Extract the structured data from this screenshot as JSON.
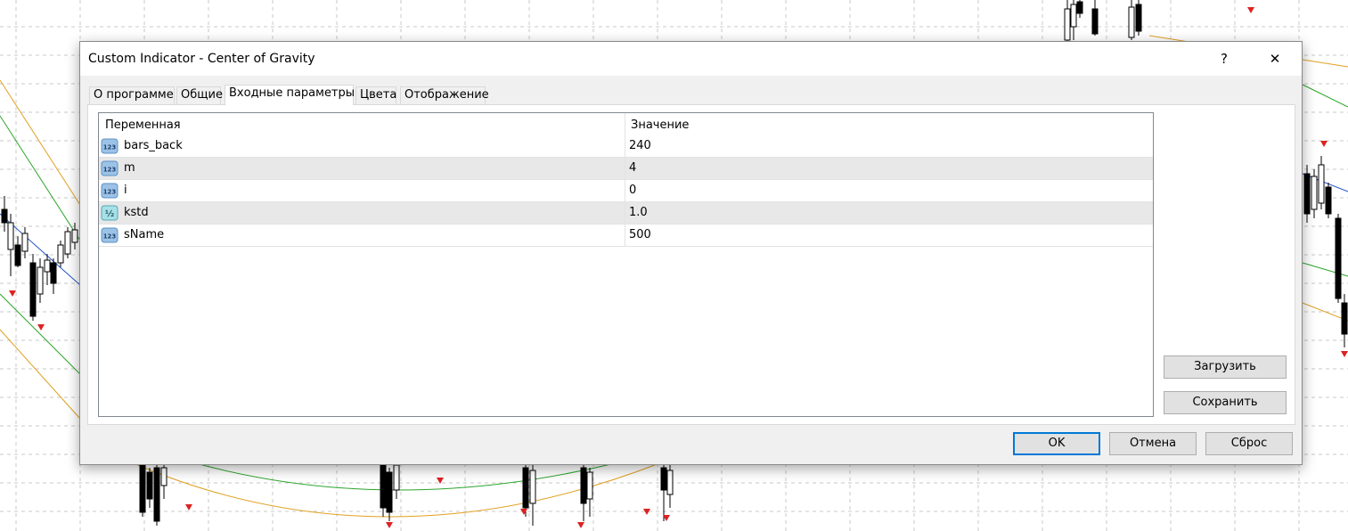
{
  "dialog": {
    "title": "Custom Indicator - Center of Gravity",
    "help_label": "?",
    "close_label": "✕"
  },
  "tabs": [
    {
      "label": "О программе",
      "active": false
    },
    {
      "label": "Общие",
      "active": false
    },
    {
      "label": "Входные параметры",
      "active": true
    },
    {
      "label": "Цвета",
      "active": false
    },
    {
      "label": "Отображение",
      "active": false
    }
  ],
  "grid": {
    "col_variable": "Переменная",
    "col_value": "Значение",
    "rows": [
      {
        "name": "bars_back",
        "value": "240",
        "icon": "integer-icon"
      },
      {
        "name": "m",
        "value": "4",
        "icon": "integer-icon"
      },
      {
        "name": "i",
        "value": "0",
        "icon": "integer-icon"
      },
      {
        "name": "kstd",
        "value": "1.0",
        "icon": "double-icon"
      },
      {
        "name": "sName",
        "value": "500",
        "icon": "integer-icon"
      }
    ]
  },
  "buttons": {
    "load": "Загрузить",
    "save": "Сохранить",
    "ok": "OK",
    "cancel": "Отмена",
    "reset": "Сброс"
  },
  "icon_text": {
    "integer": "123",
    "double": "½"
  },
  "colors": {
    "accent": "#0078d7",
    "row_alt": "#e8e8e8"
  }
}
